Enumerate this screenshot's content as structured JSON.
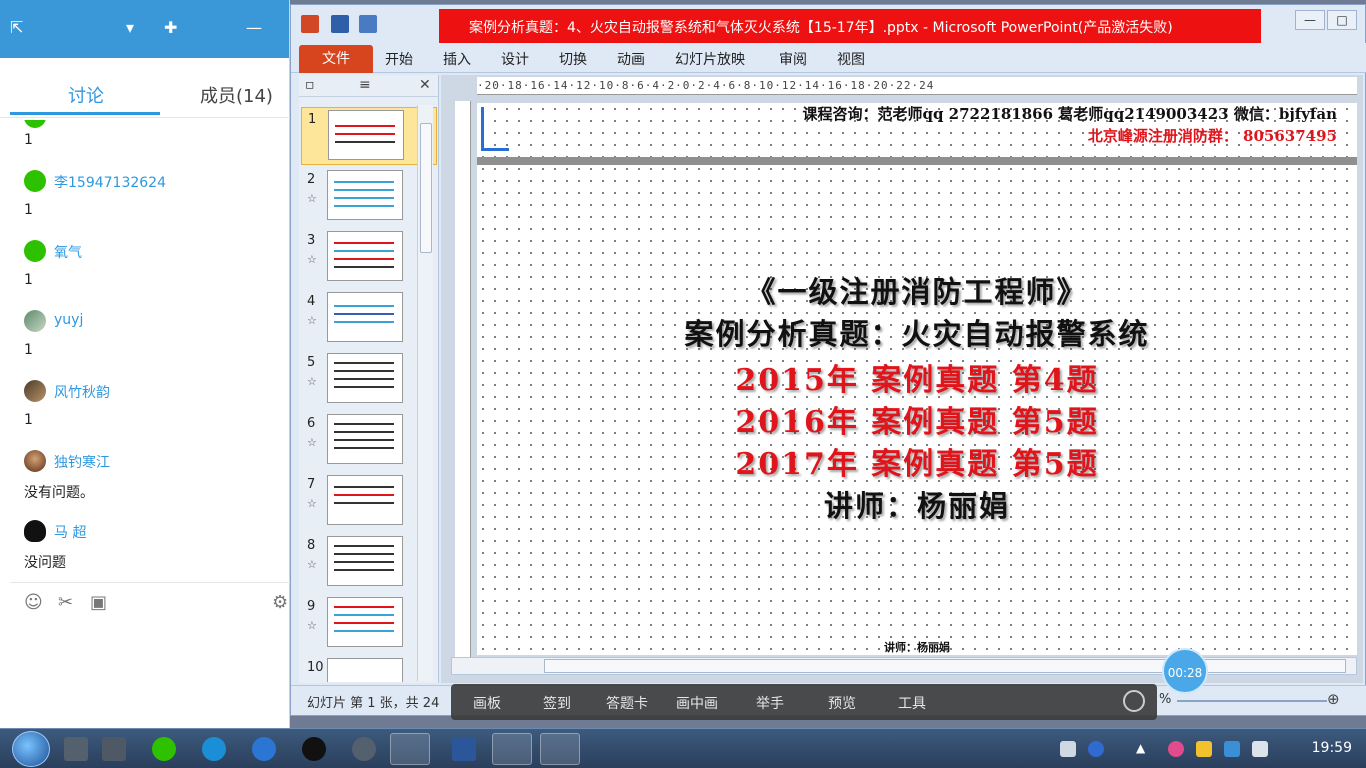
{
  "chat": {
    "tabs": {
      "discussion": "讨论",
      "members": "成员(14)"
    },
    "messages": [
      {
        "name": "",
        "text": "1"
      },
      {
        "name": "李15947132624",
        "text": "1"
      },
      {
        "name": "氧气",
        "text": "1"
      },
      {
        "name": "yuyj",
        "text": "1"
      },
      {
        "name": "风竹秋韵",
        "text": "1"
      },
      {
        "name": "独钓寒江",
        "text": "没有问题。"
      },
      {
        "name": "马 超",
        "text": "没问题"
      }
    ]
  },
  "ppt": {
    "title": "案例分析真题：4、火灾自动报警系统和气体灭火系统【15-17年】.pptx - Microsoft PowerPoint(产品激活失败)",
    "ribbon_tabs": {
      "file": "文件",
      "home": "开始",
      "insert": "插入",
      "design": "设计",
      "transitions": "切换",
      "animations": "动画",
      "slideshow": "幻灯片放映",
      "review": "审阅",
      "view": "视图"
    },
    "thumbnails": [
      "1",
      "2",
      "3",
      "4",
      "5",
      "6",
      "7",
      "8",
      "9",
      "10"
    ],
    "ruler_text": "·20·18·16·14·12·10·8·6·4·2·0·2·4·6·8·10·12·14·16·18·20·22·24",
    "status": "幻灯片 第 1 张，共 24",
    "zoom_symbol": "%"
  },
  "slide": {
    "consult": "课程咨询：范老师qq 2722181866  葛老师qq2149003423   微信：bjfyfan",
    "group": "北京峰源注册消防群：  805637495",
    "line1": "《一级注册消防工程师》",
    "line2": "案例分析真题：火灾自动报警系统",
    "line3": "2015年 案例真题 第4题",
    "line4": "2016年 案例真题 第5题",
    "line5": "2017年 案例真题 第5题",
    "line6": "讲师：杨丽娟",
    "footer": "讲师：杨丽娟"
  },
  "timer": "00:28",
  "classbar": {
    "board": "画板",
    "signin": "签到",
    "answer_card": "答题卡",
    "pip": "画中画",
    "raise_hand": "举手",
    "preview": "预览",
    "tools": "工具"
  },
  "taskbar": {
    "clock": "19:59"
  }
}
